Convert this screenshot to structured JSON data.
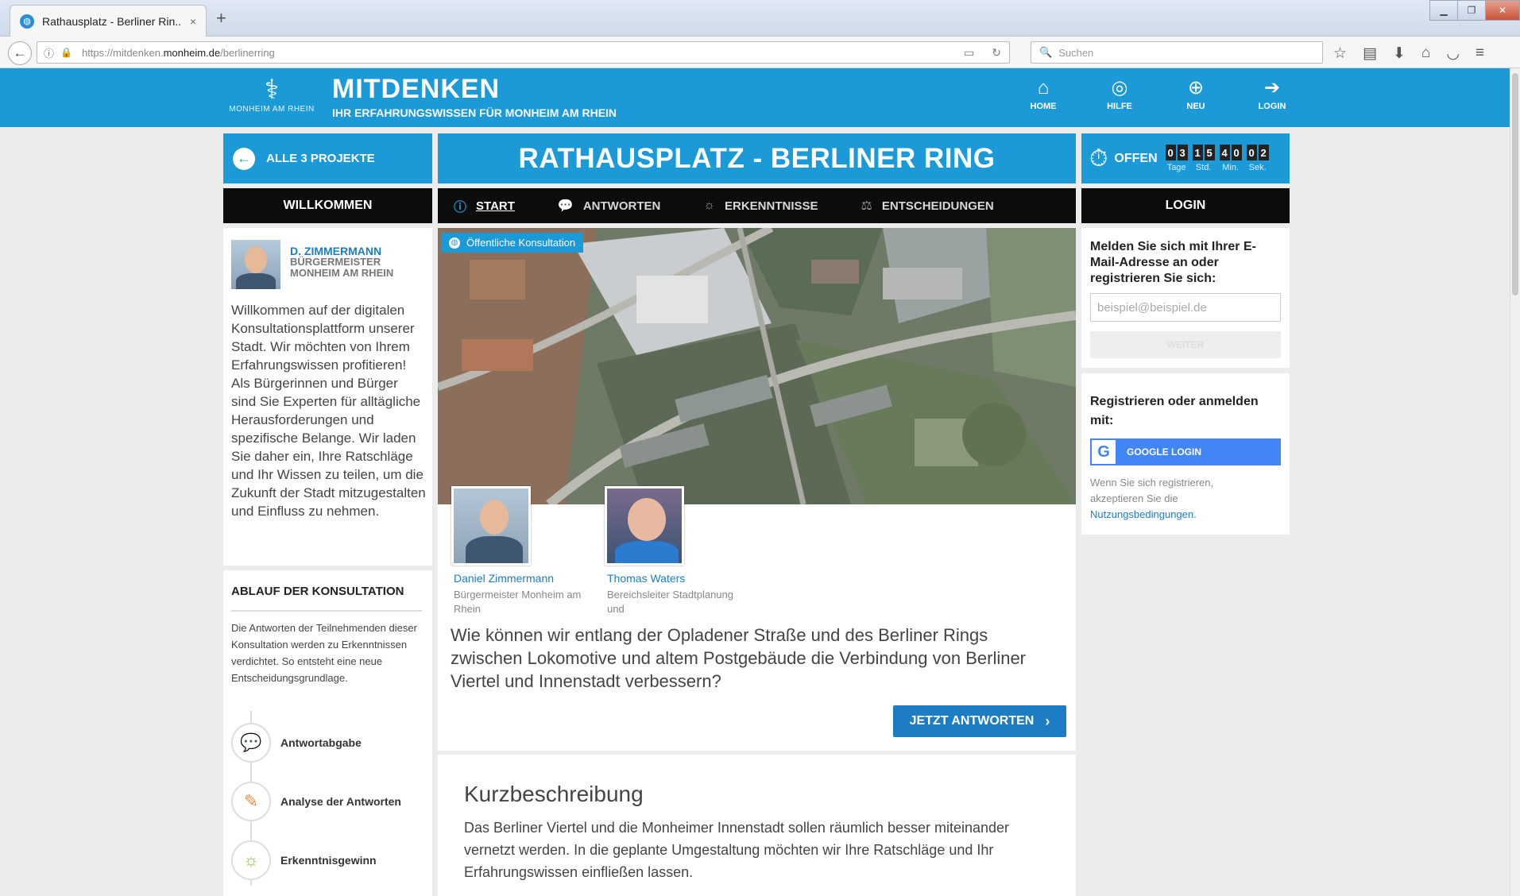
{
  "browser": {
    "tab_title": "Rathausplatz - Berliner Rin...",
    "tab_close": "×",
    "new_tab": "+",
    "url_prefix": "https://mitdenken.",
    "url_domain": "monheim.de",
    "url_path": "/berlinerring",
    "search_placeholder": "Suchen"
  },
  "header": {
    "logo_city": "MONHEIM AM RHEIN",
    "brand_name": "MITDENKEN",
    "tagline": "IHR ERFAHRUNGSWISSEN FÜR MONHEIM AM RHEIN",
    "nav": [
      {
        "label": "HOME",
        "icon": "home-icon"
      },
      {
        "label": "HILFE",
        "icon": "help-icon"
      },
      {
        "label": "NEU",
        "icon": "plus-circle-icon"
      },
      {
        "label": "LOGIN",
        "icon": "login-icon"
      }
    ]
  },
  "project_bar": {
    "all_projects": "ALLE 3 PROJEKTE",
    "title": "RATHAUSPLATZ - BERLINER RING",
    "status": "OFFEN",
    "countdown": {
      "days": "03",
      "hours": "15",
      "minutes": "40",
      "seconds": "02",
      "labels": [
        "Tage",
        "Std.",
        "Min.",
        "Sek."
      ]
    }
  },
  "tabs": {
    "left": "WILLKOMMEN",
    "items": [
      "START",
      "ANTWORTEN",
      "ERKENNTNISSE",
      "ENTSCHEIDUNGEN"
    ],
    "active": "START",
    "right": "LOGIN"
  },
  "welcome": {
    "name": "D. ZIMMERMANN",
    "role1": "BÜRGERMEISTER",
    "role2": "MONHEIM AM RHEIN",
    "text": "Willkommen auf der digitalen Konsultationsplattform unserer Stadt. Wir möchten von Ihrem Erfahrungswissen profitieren! Als Bürgerinnen und Bürger sind Sie Experten für alltägliche Herausforderungen und spezifische Belange. Wir laden Sie daher ein, Ihre Ratschläge und Ihr Wissen zu teilen, um die Zukunft der Stadt mitzugestalten und Einfluss zu nehmen."
  },
  "process": {
    "title": "ABLAUF DER KONSULTATION",
    "text": "Die Antworten der Teilnehmenden dieser Konsultation werden zu Erkenntnissen verdichtet. So entsteht eine neue Entscheidungsgrundlage.",
    "steps": [
      {
        "label": "Antwortabgabe",
        "icon": "speech-bubbles-icon"
      },
      {
        "label": "Analyse der Antworten",
        "icon": "pencil-icon"
      },
      {
        "label": "Erkenntnisgewinn",
        "icon": "lightbulb-icon"
      }
    ]
  },
  "main": {
    "badge": "Öffentliche Konsultation",
    "people": [
      {
        "name": "Daniel Zimmermann",
        "role": "Bürgermeister Monheim am Rhein"
      },
      {
        "name": "Thomas Waters",
        "role": "Bereichsleiter Stadtplanung und"
      }
    ],
    "question": "Wie können wir entlang der Opladener Straße und des Berliner Rings zwischen Lokomotive und altem Postgebäude die Verbindung von Berliner Viertel und Innenstadt verbessern?",
    "answer_button": "JETZT ANTWORTEN",
    "answer_arrow": "›",
    "desc_title": "Kurzbeschreibung",
    "desc_text": "Das Berliner Viertel und die Monheimer Innenstadt sollen räumlich besser miteinander vernetzt werden. In die geplante Umgestaltung möchten wir Ihre Ratschläge und Ihr Erfahrungswissen einfließen lassen."
  },
  "login": {
    "prompt": "Melden Sie sich mit Ihrer E-Mail-Adresse an oder registrieren Sie sich:",
    "email_placeholder": "beispiel@beispiel.de",
    "continue": "WEITER",
    "register_title": "Registrieren oder anmelden mit:",
    "google": "GOOGLE LOGIN",
    "terms_prefix": "Wenn Sie sich registrieren, akzeptieren Sie die",
    "terms_link": "Nutzungsbedingungen."
  },
  "colors": {
    "brand_blue": "#1c9ad8",
    "dark_blue": "#1c7dc4",
    "black_bar": "#0c0c0c",
    "google_blue": "#4285f4"
  }
}
